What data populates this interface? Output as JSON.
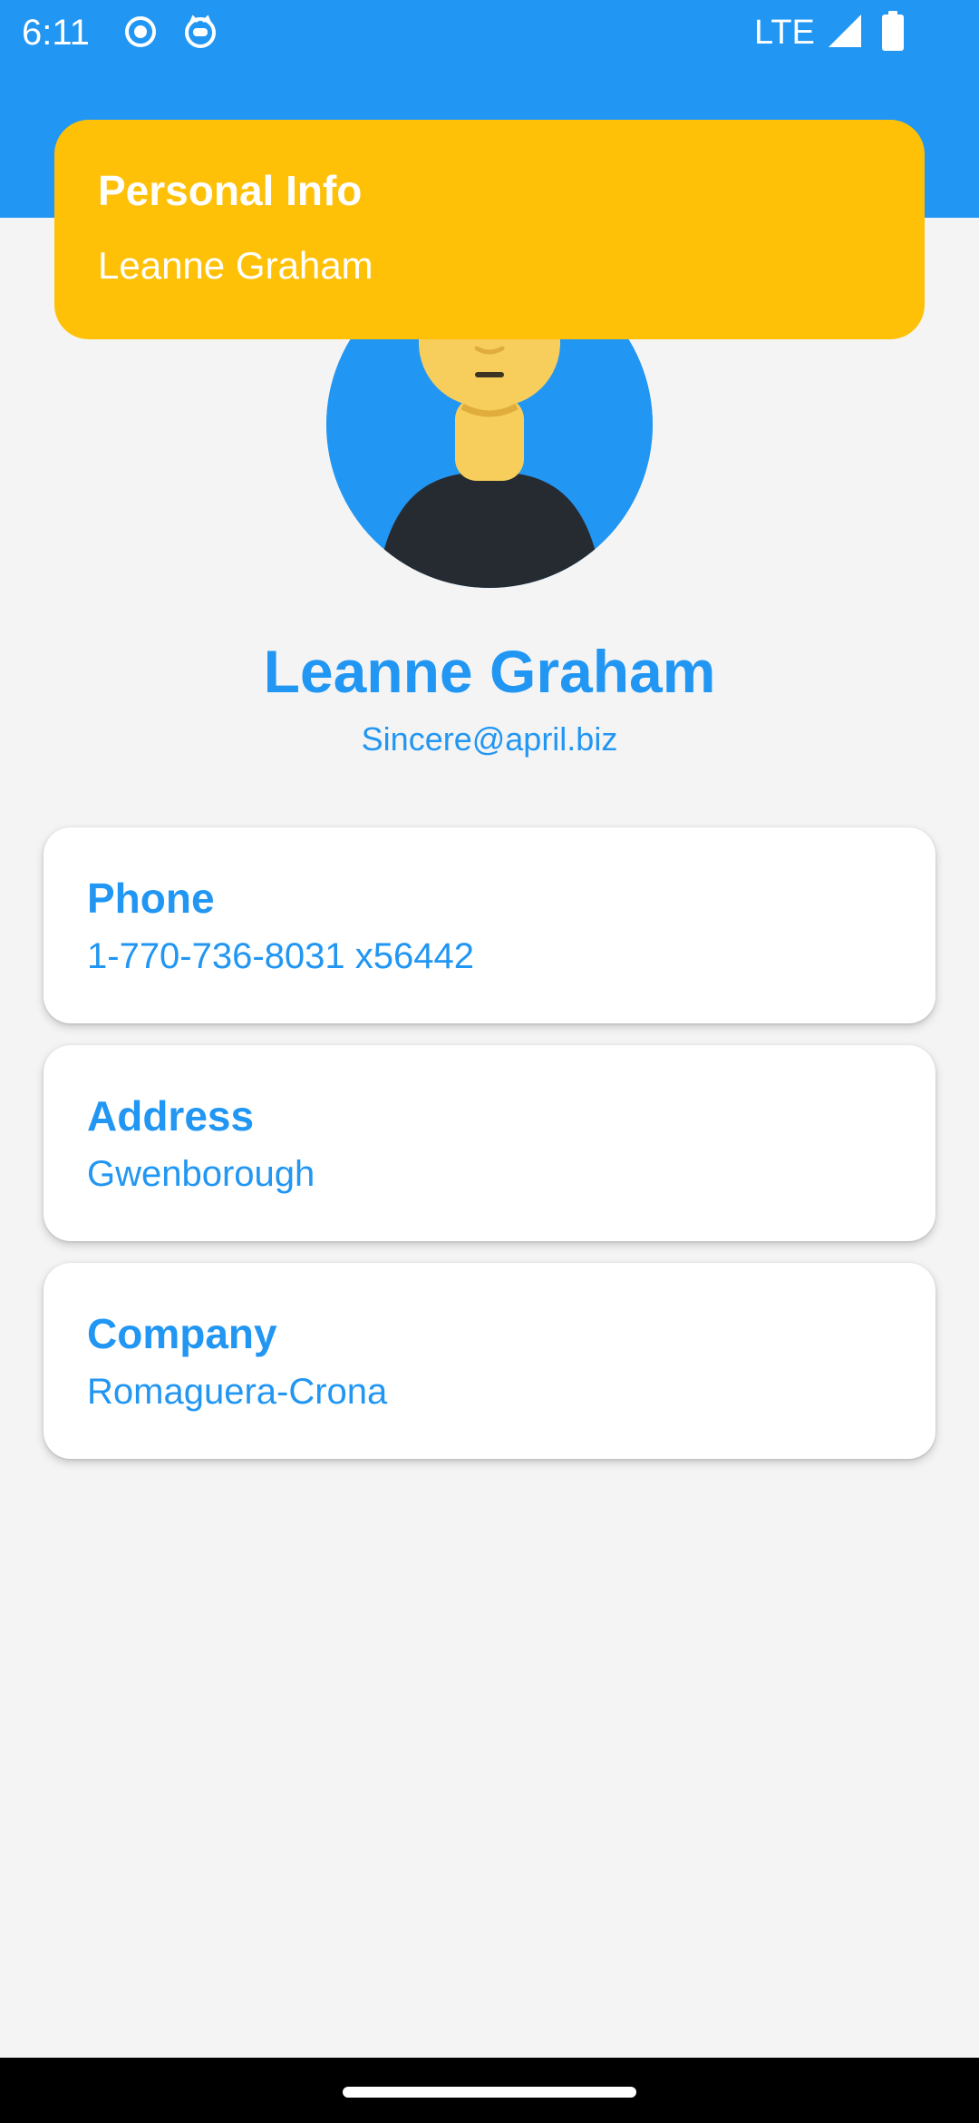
{
  "status_bar": {
    "time": "6:11",
    "network": "LTE",
    "icons": [
      "circle-record-icon",
      "cat-face-icon",
      "signal-icon",
      "battery-icon"
    ]
  },
  "banner": {
    "title": "Personal Info",
    "subtitle": "Leanne Graham"
  },
  "profile": {
    "name": "Leanne Graham",
    "email": "Sincere@april.biz",
    "avatar_icon": "worried-person-icon"
  },
  "cards": {
    "phone": {
      "label": "Phone",
      "value": "1-770-736-8031 x56442"
    },
    "address": {
      "label": "Address",
      "value": "Gwenborough"
    },
    "company": {
      "label": "Company",
      "value": "Romaguera-Crona"
    }
  },
  "colors": {
    "primary": "#2196f3",
    "accent": "#ffc107",
    "background": "#f4f4f4"
  }
}
